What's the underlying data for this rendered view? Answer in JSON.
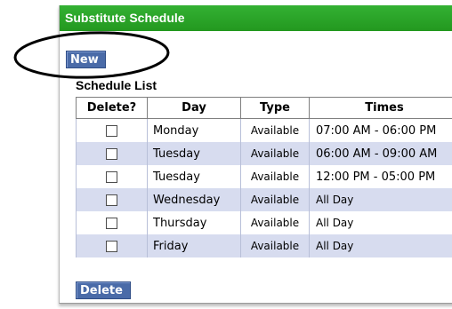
{
  "panel": {
    "title": "Substitute Schedule"
  },
  "toolbar": {
    "new_label": "New",
    "delete_label": "Delete"
  },
  "section": {
    "title": "Schedule List"
  },
  "table": {
    "headers": [
      "Delete?",
      "Day",
      "Type",
      "Times"
    ],
    "rows": [
      {
        "day": "Monday",
        "type": "Available",
        "times": "07:00 AM - 06:00 PM",
        "checked": false
      },
      {
        "day": "Tuesday",
        "type": "Available",
        "times": "06:00 AM - 09:00 AM",
        "checked": false
      },
      {
        "day": "Tuesday",
        "type": "Available",
        "times": "12:00 PM - 05:00 PM",
        "checked": false
      },
      {
        "day": "Wednesday",
        "type": "Available",
        "times": "All Day",
        "checked": false
      },
      {
        "day": "Thursday",
        "type": "Available",
        "times": "All Day",
        "checked": false
      },
      {
        "day": "Friday",
        "type": "Available",
        "times": "All Day",
        "checked": false
      }
    ]
  },
  "colors": {
    "header_green": "#2aa62a",
    "button_blue": "#4a6ba8",
    "row_alt": "#d7dcef"
  },
  "icons": {
    "checkbox": "checkbox-icon",
    "annotation": "highlight-ellipse"
  }
}
